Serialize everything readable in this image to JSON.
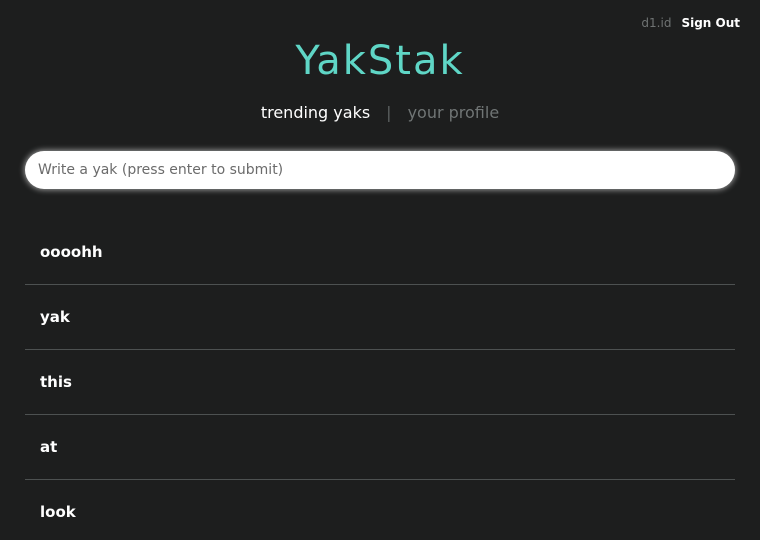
{
  "header": {
    "username": "d1.id",
    "sign_out_label": "Sign Out",
    "logo_text": "YakStak"
  },
  "nav": {
    "trending_label": "trending yaks",
    "separator": "|",
    "profile_label": "your profile"
  },
  "composer": {
    "placeholder": "Write a yak (press enter to submit)",
    "value": ""
  },
  "yaks": [
    {
      "text": "oooohh"
    },
    {
      "text": "yak"
    },
    {
      "text": "this"
    },
    {
      "text": "at"
    },
    {
      "text": "look"
    }
  ],
  "colors": {
    "background": "#1d1e1e",
    "accent": "#5fd6c6",
    "divider": "#4d5151"
  }
}
